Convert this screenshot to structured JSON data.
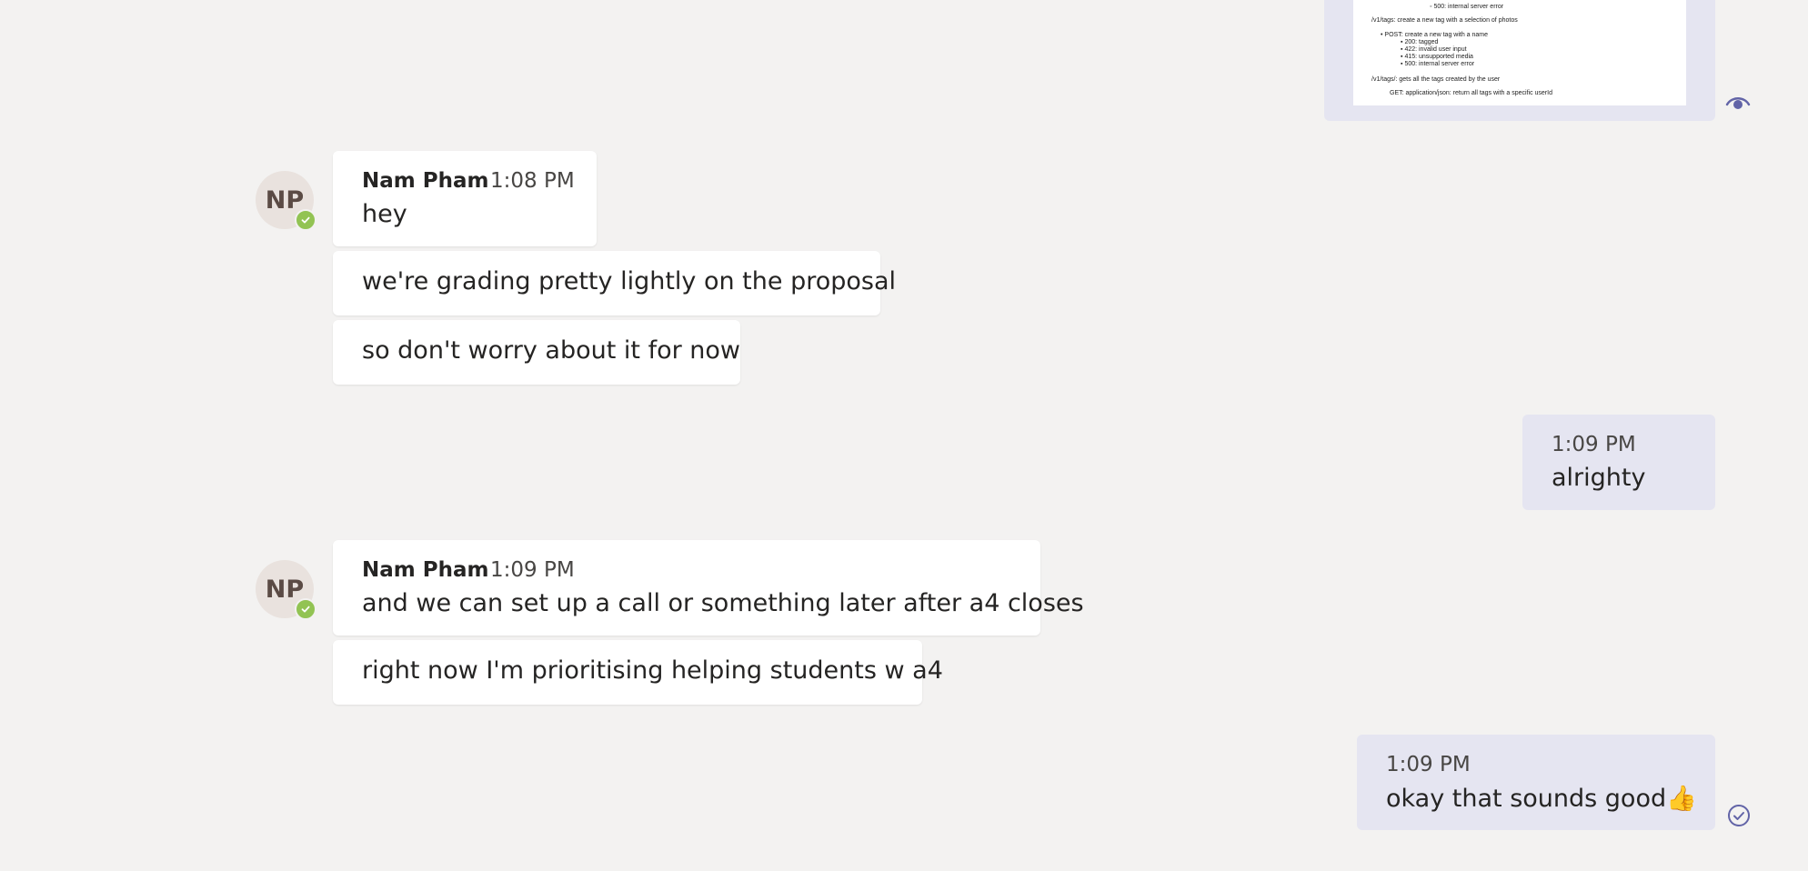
{
  "attachment": {
    "lines": [
      "",
      "500: internal server error",
      "/v1/tags: create a new tag with a selection of photos",
      "POST: create a new tag with a name",
      "200: tagged",
      "422: invalid user input",
      "415: unsupported media",
      "500: internal server error",
      "/v1/tags/: gets all the tags created by the user",
      "GET: application/json: return all tags with a specific userId"
    ]
  },
  "messages": {
    "group1": {
      "avatar_initials": "NP",
      "sender": "Nam Pham",
      "time": "1:08 PM",
      "lines": [
        "hey",
        "we're grading pretty lightly on the proposal",
        "so don't worry about it for now"
      ]
    },
    "outgoing1": {
      "time": "1:09 PM",
      "text": "alrighty"
    },
    "group2": {
      "avatar_initials": "NP",
      "sender": "Nam Pham",
      "time": "1:09 PM",
      "lines": [
        "and we can set up a call or something later after a4 closes",
        "right now I'm prioritising helping students w a4"
      ]
    },
    "outgoing2": {
      "time": "1:09 PM",
      "text": "okay that sounds good👍"
    }
  },
  "colors": {
    "background": "#f3f2f1",
    "incoming_bubble": "#ffffff",
    "outgoing_bubble": "#e5e5f1",
    "accent": "#6264a7",
    "presence_available": "#92c353"
  },
  "icons": {
    "read_receipt": "eye-icon",
    "sent_receipt": "check-circle-icon",
    "presence": "available-check-icon"
  }
}
